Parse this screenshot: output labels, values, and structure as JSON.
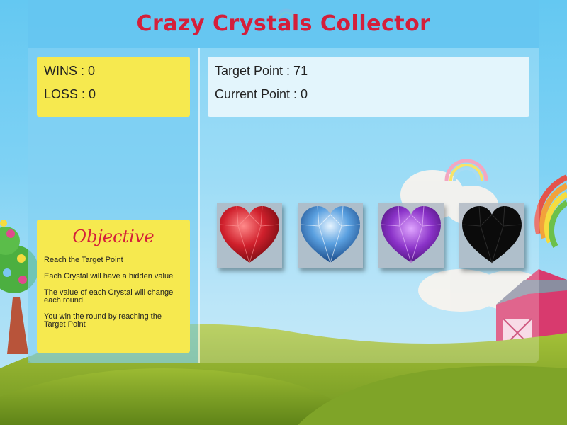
{
  "title": "Crazy Crystals Collector",
  "scores": {
    "wins_label": "WINS : 0",
    "loss_label": "LOSS : 0"
  },
  "game": {
    "target_label": "Target Point : 71",
    "current_label": "Current Point : 0"
  },
  "objective": {
    "title": "Objective",
    "items": [
      "Reach the Target Point",
      "Each Crystal will have a hidden value",
      "The value of each Crystal will change each round",
      "You win the round by reaching the Target Point"
    ]
  },
  "crystals": [
    {
      "name": "red",
      "icon": "red-heart-crystal-icon",
      "color": "#c8202a"
    },
    {
      "name": "blue",
      "icon": "blue-heart-crystal-icon",
      "color": "#2a6fb8"
    },
    {
      "name": "purple",
      "icon": "purple-heart-crystal-icon",
      "color": "#7b2cbf"
    },
    {
      "name": "black",
      "icon": "black-heart-crystal-icon",
      "color": "#111111"
    }
  ],
  "colors": {
    "title": "#d41f3a",
    "yellow_panel": "#f6e94f",
    "target_panel": "#e3f5fc",
    "sky": "#64c8f2"
  }
}
